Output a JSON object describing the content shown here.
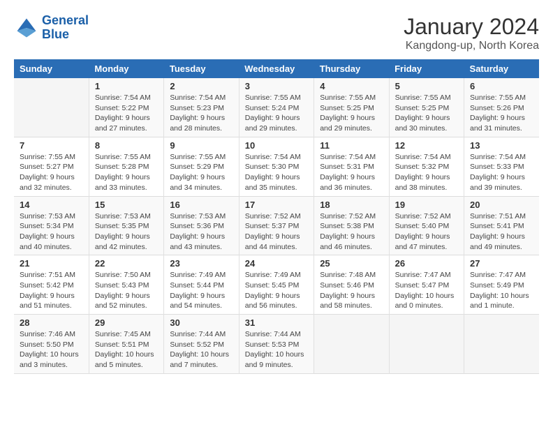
{
  "logo": {
    "line1": "General",
    "line2": "Blue"
  },
  "title": "January 2024",
  "location": "Kangdong-up, North Korea",
  "days_header": [
    "Sunday",
    "Monday",
    "Tuesday",
    "Wednesday",
    "Thursday",
    "Friday",
    "Saturday"
  ],
  "weeks": [
    [
      {
        "day": "",
        "sunrise": "",
        "sunset": "",
        "daylight": ""
      },
      {
        "day": "1",
        "sunrise": "Sunrise: 7:54 AM",
        "sunset": "Sunset: 5:22 PM",
        "daylight": "Daylight: 9 hours and 27 minutes."
      },
      {
        "day": "2",
        "sunrise": "Sunrise: 7:54 AM",
        "sunset": "Sunset: 5:23 PM",
        "daylight": "Daylight: 9 hours and 28 minutes."
      },
      {
        "day": "3",
        "sunrise": "Sunrise: 7:55 AM",
        "sunset": "Sunset: 5:24 PM",
        "daylight": "Daylight: 9 hours and 29 minutes."
      },
      {
        "day": "4",
        "sunrise": "Sunrise: 7:55 AM",
        "sunset": "Sunset: 5:25 PM",
        "daylight": "Daylight: 9 hours and 29 minutes."
      },
      {
        "day": "5",
        "sunrise": "Sunrise: 7:55 AM",
        "sunset": "Sunset: 5:25 PM",
        "daylight": "Daylight: 9 hours and 30 minutes."
      },
      {
        "day": "6",
        "sunrise": "Sunrise: 7:55 AM",
        "sunset": "Sunset: 5:26 PM",
        "daylight": "Daylight: 9 hours and 31 minutes."
      }
    ],
    [
      {
        "day": "7",
        "sunrise": "Sunrise: 7:55 AM",
        "sunset": "Sunset: 5:27 PM",
        "daylight": "Daylight: 9 hours and 32 minutes."
      },
      {
        "day": "8",
        "sunrise": "Sunrise: 7:55 AM",
        "sunset": "Sunset: 5:28 PM",
        "daylight": "Daylight: 9 hours and 33 minutes."
      },
      {
        "day": "9",
        "sunrise": "Sunrise: 7:55 AM",
        "sunset": "Sunset: 5:29 PM",
        "daylight": "Daylight: 9 hours and 34 minutes."
      },
      {
        "day": "10",
        "sunrise": "Sunrise: 7:54 AM",
        "sunset": "Sunset: 5:30 PM",
        "daylight": "Daylight: 9 hours and 35 minutes."
      },
      {
        "day": "11",
        "sunrise": "Sunrise: 7:54 AM",
        "sunset": "Sunset: 5:31 PM",
        "daylight": "Daylight: 9 hours and 36 minutes."
      },
      {
        "day": "12",
        "sunrise": "Sunrise: 7:54 AM",
        "sunset": "Sunset: 5:32 PM",
        "daylight": "Daylight: 9 hours and 38 minutes."
      },
      {
        "day": "13",
        "sunrise": "Sunrise: 7:54 AM",
        "sunset": "Sunset: 5:33 PM",
        "daylight": "Daylight: 9 hours and 39 minutes."
      }
    ],
    [
      {
        "day": "14",
        "sunrise": "Sunrise: 7:53 AM",
        "sunset": "Sunset: 5:34 PM",
        "daylight": "Daylight: 9 hours and 40 minutes."
      },
      {
        "day": "15",
        "sunrise": "Sunrise: 7:53 AM",
        "sunset": "Sunset: 5:35 PM",
        "daylight": "Daylight: 9 hours and 42 minutes."
      },
      {
        "day": "16",
        "sunrise": "Sunrise: 7:53 AM",
        "sunset": "Sunset: 5:36 PM",
        "daylight": "Daylight: 9 hours and 43 minutes."
      },
      {
        "day": "17",
        "sunrise": "Sunrise: 7:52 AM",
        "sunset": "Sunset: 5:37 PM",
        "daylight": "Daylight: 9 hours and 44 minutes."
      },
      {
        "day": "18",
        "sunrise": "Sunrise: 7:52 AM",
        "sunset": "Sunset: 5:38 PM",
        "daylight": "Daylight: 9 hours and 46 minutes."
      },
      {
        "day": "19",
        "sunrise": "Sunrise: 7:52 AM",
        "sunset": "Sunset: 5:40 PM",
        "daylight": "Daylight: 9 hours and 47 minutes."
      },
      {
        "day": "20",
        "sunrise": "Sunrise: 7:51 AM",
        "sunset": "Sunset: 5:41 PM",
        "daylight": "Daylight: 9 hours and 49 minutes."
      }
    ],
    [
      {
        "day": "21",
        "sunrise": "Sunrise: 7:51 AM",
        "sunset": "Sunset: 5:42 PM",
        "daylight": "Daylight: 9 hours and 51 minutes."
      },
      {
        "day": "22",
        "sunrise": "Sunrise: 7:50 AM",
        "sunset": "Sunset: 5:43 PM",
        "daylight": "Daylight: 9 hours and 52 minutes."
      },
      {
        "day": "23",
        "sunrise": "Sunrise: 7:49 AM",
        "sunset": "Sunset: 5:44 PM",
        "daylight": "Daylight: 9 hours and 54 minutes."
      },
      {
        "day": "24",
        "sunrise": "Sunrise: 7:49 AM",
        "sunset": "Sunset: 5:45 PM",
        "daylight": "Daylight: 9 hours and 56 minutes."
      },
      {
        "day": "25",
        "sunrise": "Sunrise: 7:48 AM",
        "sunset": "Sunset: 5:46 PM",
        "daylight": "Daylight: 9 hours and 58 minutes."
      },
      {
        "day": "26",
        "sunrise": "Sunrise: 7:47 AM",
        "sunset": "Sunset: 5:47 PM",
        "daylight": "Daylight: 10 hours and 0 minutes."
      },
      {
        "day": "27",
        "sunrise": "Sunrise: 7:47 AM",
        "sunset": "Sunset: 5:49 PM",
        "daylight": "Daylight: 10 hours and 1 minute."
      }
    ],
    [
      {
        "day": "28",
        "sunrise": "Sunrise: 7:46 AM",
        "sunset": "Sunset: 5:50 PM",
        "daylight": "Daylight: 10 hours and 3 minutes."
      },
      {
        "day": "29",
        "sunrise": "Sunrise: 7:45 AM",
        "sunset": "Sunset: 5:51 PM",
        "daylight": "Daylight: 10 hours and 5 minutes."
      },
      {
        "day": "30",
        "sunrise": "Sunrise: 7:44 AM",
        "sunset": "Sunset: 5:52 PM",
        "daylight": "Daylight: 10 hours and 7 minutes."
      },
      {
        "day": "31",
        "sunrise": "Sunrise: 7:44 AM",
        "sunset": "Sunset: 5:53 PM",
        "daylight": "Daylight: 10 hours and 9 minutes."
      },
      {
        "day": "",
        "sunrise": "",
        "sunset": "",
        "daylight": ""
      },
      {
        "day": "",
        "sunrise": "",
        "sunset": "",
        "daylight": ""
      },
      {
        "day": "",
        "sunrise": "",
        "sunset": "",
        "daylight": ""
      }
    ]
  ]
}
